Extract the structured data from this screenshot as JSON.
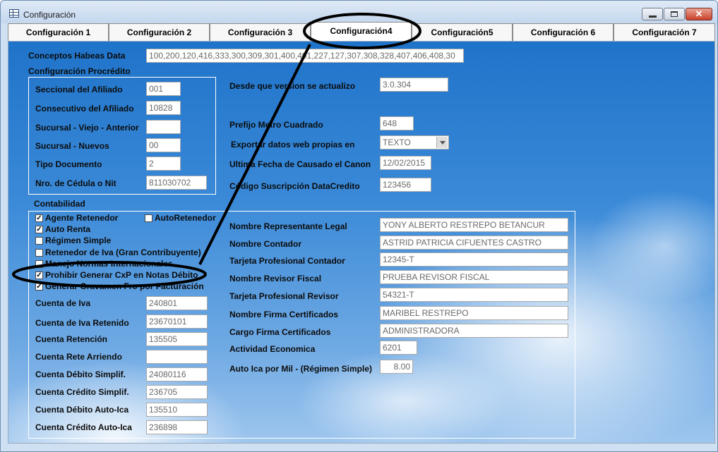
{
  "window": {
    "title": "Configuración"
  },
  "tabs": [
    {
      "label": "Configuración 1",
      "active": false
    },
    {
      "label": "Configuración 2",
      "active": false
    },
    {
      "label": "Configuración 3",
      "active": false
    },
    {
      "label": "Configuración4",
      "active": true
    },
    {
      "label": "Configuración5",
      "active": false
    },
    {
      "label": "Configuración 6",
      "active": false
    },
    {
      "label": "Configuración 7",
      "active": false
    }
  ],
  "habeas": {
    "label": "Conceptos Habeas Data",
    "value": "100,200,120,416,333,300,309,301,400,401,227,127,307,308,328,407,406,408,30"
  },
  "procredito": {
    "heading": "Configuración Procrédito",
    "fields": [
      {
        "label": "Seccional del Afiliado",
        "value": "001"
      },
      {
        "label": "Consecutivo del Afiliado",
        "value": "10828"
      },
      {
        "label": "Sucursal - Viejo - Anterior",
        "value": ""
      },
      {
        "label": "Sucursal - Nuevos",
        "value": "00"
      },
      {
        "label": "Tipo Documento",
        "value": "2"
      },
      {
        "label": "Nro. de Cédula o Nit",
        "value": "811030702"
      }
    ]
  },
  "right_top": {
    "version": {
      "label": "Desde que version se actualizo",
      "value": "3.0.304"
    },
    "prefijo": {
      "label": "Prefijo Metro Cuadrado",
      "value": "648"
    },
    "exportar": {
      "label": "Exportar datos web propias en",
      "value": "TEXTO"
    },
    "ultima": {
      "label": "Ultima Fecha de Causado el Canon",
      "value": "12/02/2015"
    },
    "datacredito": {
      "label": "Código Suscripción DataCredito",
      "value": "123456"
    }
  },
  "contabilidad": {
    "heading": "Contabilidad",
    "checkboxes": [
      {
        "label": "Agente Retenedor",
        "checked": true
      },
      {
        "label": "AutoRetenedor",
        "checked": false
      },
      {
        "label": "Auto Renta",
        "checked": true
      },
      {
        "label": "Régimen Simple",
        "checked": false
      },
      {
        "label": "Retenedor de Iva (Gran Contribuyente)",
        "checked": false
      },
      {
        "label": "Manejo Normas Internacionales",
        "checked": false
      },
      {
        "label": "Prohibir Generar CxP en Notas Débito",
        "checked": true
      },
      {
        "label": "Generar Gravamen Fro por Facturación",
        "checked": true
      }
    ],
    "cuentas": [
      {
        "label": "Cuenta de Iva",
        "value": "240801"
      },
      {
        "label": "Cuenta de Iva Retenido",
        "value": "23670101"
      },
      {
        "label": "Cuenta Retención",
        "value": "135505"
      },
      {
        "label": "Cuenta Rete Arriendo",
        "value": ""
      },
      {
        "label": "Cuenta Débito Simplif.",
        "value": "24080116"
      },
      {
        "label": "Cuenta Crédito Simplif.",
        "value": "236705"
      },
      {
        "label": "Cuenta Débito Auto-Ica",
        "value": "135510"
      },
      {
        "label": "Cuenta Crédito  Auto-Ica",
        "value": "236898"
      }
    ],
    "right": [
      {
        "label": "Nombre Representante Legal",
        "value": "YONY ALBERTO RESTREPO BETANCUR"
      },
      {
        "label": "Nombre Contador",
        "value": "ASTRID PATRICIA CIFUENTES CASTRO"
      },
      {
        "label": "Tarjeta Profesional Contador",
        "value": "12345-T"
      },
      {
        "label": "Nombre Revisor Fiscal",
        "value": "PRUEBA REVISOR FISCAL"
      },
      {
        "label": "Tarjeta Profesional Revisor",
        "value": "54321-T"
      },
      {
        "label": "Nombre Firma Certificados",
        "value": "MARIBEL RESTREPO"
      },
      {
        "label": "Cargo Firma Certificados",
        "value": "ADMINISTRADORA"
      },
      {
        "label": "Actividad Economica",
        "value": "6201"
      },
      {
        "label": "Auto Ica por Mil - (Régimen Simple)",
        "value": "8.00"
      }
    ]
  },
  "colors": {
    "window_bg": "#cfe0f3",
    "callout": "#000000",
    "sky": "#2d7fd2"
  }
}
